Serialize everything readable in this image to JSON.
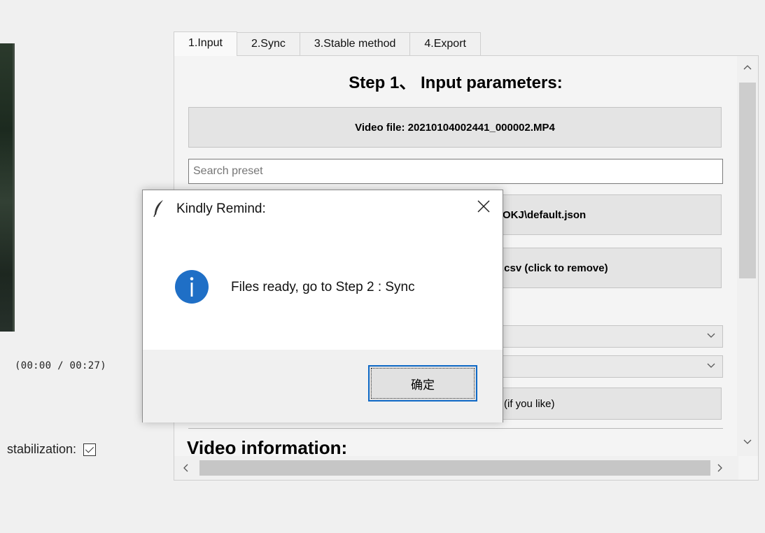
{
  "left_panel": {
    "time": "(00:00 / 00:27)",
    "stabilization_label": "stabilization:"
  },
  "tabs": [
    "1.Input",
    "2.Sync",
    "3.Stable method",
    "4.Export"
  ],
  "step": {
    "title": "Step 1、 Input parameters:",
    "video_file_button": "Video file: 20210104002441_000002.MP4",
    "search_placeholder": "Search preset",
    "preset_button_visible": "OKJ\\default.json",
    "gyro_button_visible": ".csv (click to remove)",
    "extra_button_visible": "(if you like)",
    "section_title": "Video information:"
  },
  "dialog": {
    "title": "Kindly Remind:",
    "message": "Files ready, go to Step 2 : Sync",
    "ok_label": "确定"
  },
  "colors": {
    "accent": "#0f69c6",
    "info_icon": "#1f6fc6"
  }
}
